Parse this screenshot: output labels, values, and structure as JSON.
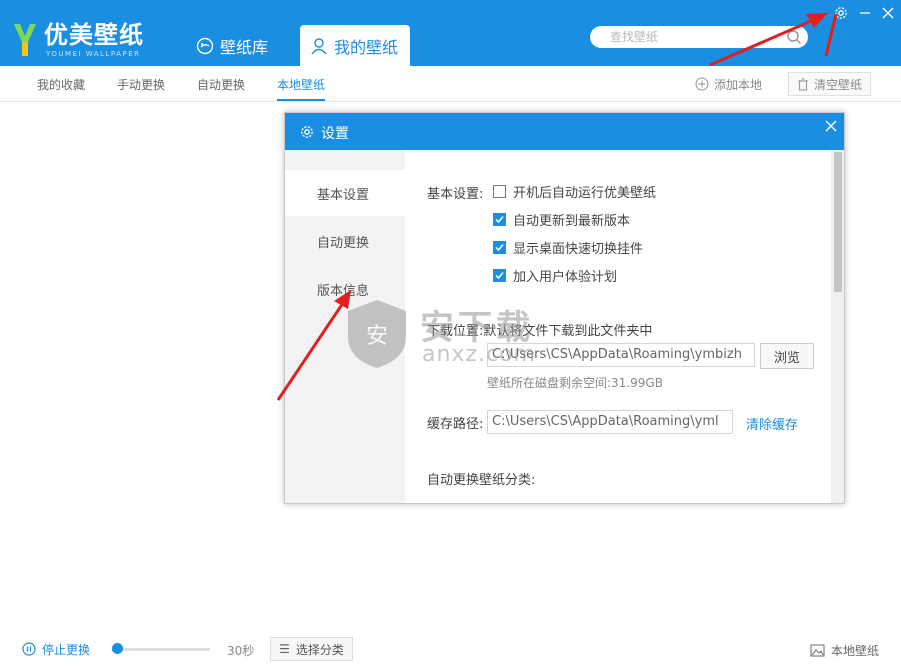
{
  "app": {
    "logo_text": "优美壁纸",
    "logo_sub": "YOUMEI WALLPAPER"
  },
  "nav": {
    "tabs": [
      {
        "label": "壁纸库",
        "icon": "palette-icon",
        "active": false
      },
      {
        "label": "我的壁纸",
        "icon": "user-icon",
        "active": true
      }
    ]
  },
  "search": {
    "placeholder": "查找壁纸"
  },
  "subnav": {
    "items": [
      "我的收藏",
      "手动更换",
      "自动更换",
      "本地壁纸"
    ],
    "active": "本地壁纸",
    "add_local": "添加本地",
    "clear_wallpaper": "清空壁纸"
  },
  "dialog": {
    "title": "设置",
    "sidebar": [
      "基本设置",
      "自动更换",
      "版本信息"
    ],
    "basic_label": "基本设置:",
    "options": [
      {
        "label": "开机后自动运行优美壁纸",
        "checked": false
      },
      {
        "label": "自动更新到最新版本",
        "checked": true
      },
      {
        "label": "显示桌面快速切换挂件",
        "checked": true
      },
      {
        "label": "加入用户体验计划",
        "checked": true
      }
    ],
    "download_label": "下载位置:默认将文件下载到此文件夹中",
    "download_path": "C:\\Users\\CS\\AppData\\Roaming\\ymbizh",
    "browse_btn": "浏览",
    "disk_space": "壁纸所在磁盘剩余空间:31.99GB",
    "cache_label": "缓存路径:",
    "cache_path": "C:\\Users\\CS\\AppData\\Roaming\\yml",
    "clear_cache": "清除缓存",
    "auto_category_label": "自动更换壁纸分类:"
  },
  "watermark": {
    "text": "安下载",
    "domain": "anxz.com",
    "shield_char": "安"
  },
  "footer": {
    "stop_label": "停止更换",
    "interval": "30秒",
    "interval_fraction": 0.05,
    "category_btn": "选择分类",
    "local_btn": "本地壁纸"
  },
  "colors": {
    "accent": "#1a8ee0",
    "arrow": "#e02020"
  }
}
